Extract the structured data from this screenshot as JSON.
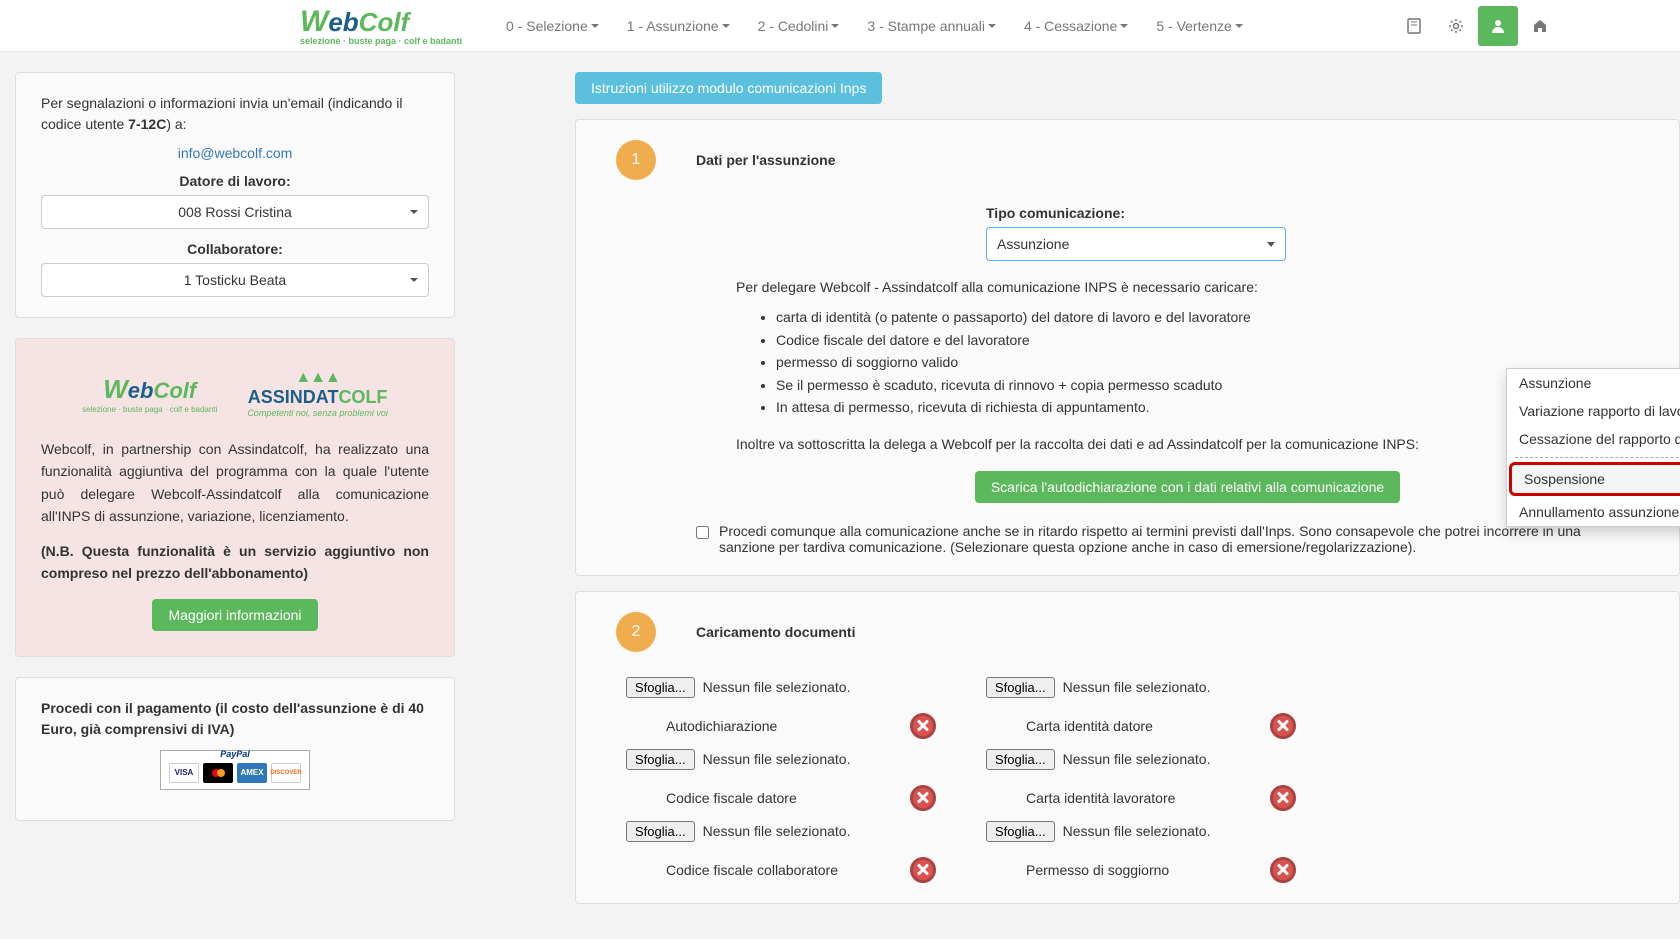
{
  "nav": {
    "items": [
      "0 - Selezione",
      "1 - Assunzione",
      "2 - Cedolini",
      "3 - Stampe annuali",
      "4 - Cessazione",
      "5 - Vertenze"
    ]
  },
  "logo": {
    "tagline": "selezione · buste paga · colf e badanti"
  },
  "sidebar": {
    "info_text_1": "Per segnalazioni o informazioni invia un'email (indicando il codice utente ",
    "info_code": "7-12C",
    "info_text_2": ") a:",
    "info_email": "info@webcolf.com",
    "datore_label": "Datore di lavoro:",
    "datore_value": "008 Rossi Cristina",
    "collab_label": "Collaboratore:",
    "collab_value": "1 Tosticku Beata",
    "assindat_tagline": "Competenti noi, senza problemi voi",
    "partner_text": "Webcolf, in partnership con Assindatcolf, ha realizzato una funzionalità aggiuntiva del programma con la quale l'utente può delegare Webcolf-Assindatcolf alla comunicazione all'INPS di assunzione, variazione, licenziamento.",
    "partner_note": "(N.B. Questa funzionalità è un servizio aggiuntivo non compreso nel prezzo dell'abbonamento)",
    "more_info_btn": "Maggiori informazioni",
    "payment_text": "Procedi con il pagamento (il costo dell'assunzione è di 40 Euro, già comprensivi di IVA)",
    "paypal_label": "PayPal"
  },
  "main": {
    "instructions_btn": "Istruzioni utilizzo modulo comunicazioni Inps",
    "step1": {
      "num": "1",
      "title": "Dati per l'assunzione",
      "field_label": "Tipo comunicazione:",
      "field_value": "Assunzione",
      "dropdown": [
        "Assunzione",
        "Variazione rapporto di lavoro",
        "Cessazione del rapporto di lavoro",
        "Sospensione",
        "Annullamento assunzione"
      ],
      "delega_intro": "Per delegare Webcolf - Assindatcolf alla comunicazione INPS è necessario caricare:",
      "delega_items": [
        "carta di identità (o patente o passaporto) del datore di lavoro e del lavoratore",
        "Codice fiscale del datore e del lavoratore",
        "permesso di soggiorno valido",
        "Se il permesso è scaduto, ricevuta di rinnovo + copia permesso scaduto",
        "In attesa di permesso, ricevuta di richiesta di appuntamento."
      ],
      "delega_footer": "Inoltre va sottoscritta la delega a Webcolf per la raccolta dei dati e ad Assindatcolf per la comunicazione INPS:",
      "download_btn": "Scarica l'autodichiarazione con i dati relativi alla comunicazione",
      "checkbox_text": "Procedi comunque alla comunicazione anche se in ritardo rispetto ai termini previsti dall'Inps. Sono consapevole che potrei incorrere in una sanzione per tardiva comunicazione. (Selezionare questa opzione anche in caso di emersione/regolarizzazione)."
    },
    "step2": {
      "num": "2",
      "title": "Caricamento documenti",
      "browse_label": "Sfoglia...",
      "no_file": "Nessun file selezionato.",
      "docs": [
        "Autodichiarazione",
        "Carta identità datore",
        "Codice fiscale datore",
        "Carta identità lavoratore",
        "Codice fiscale collaboratore",
        "Permesso di soggiorno"
      ]
    }
  }
}
